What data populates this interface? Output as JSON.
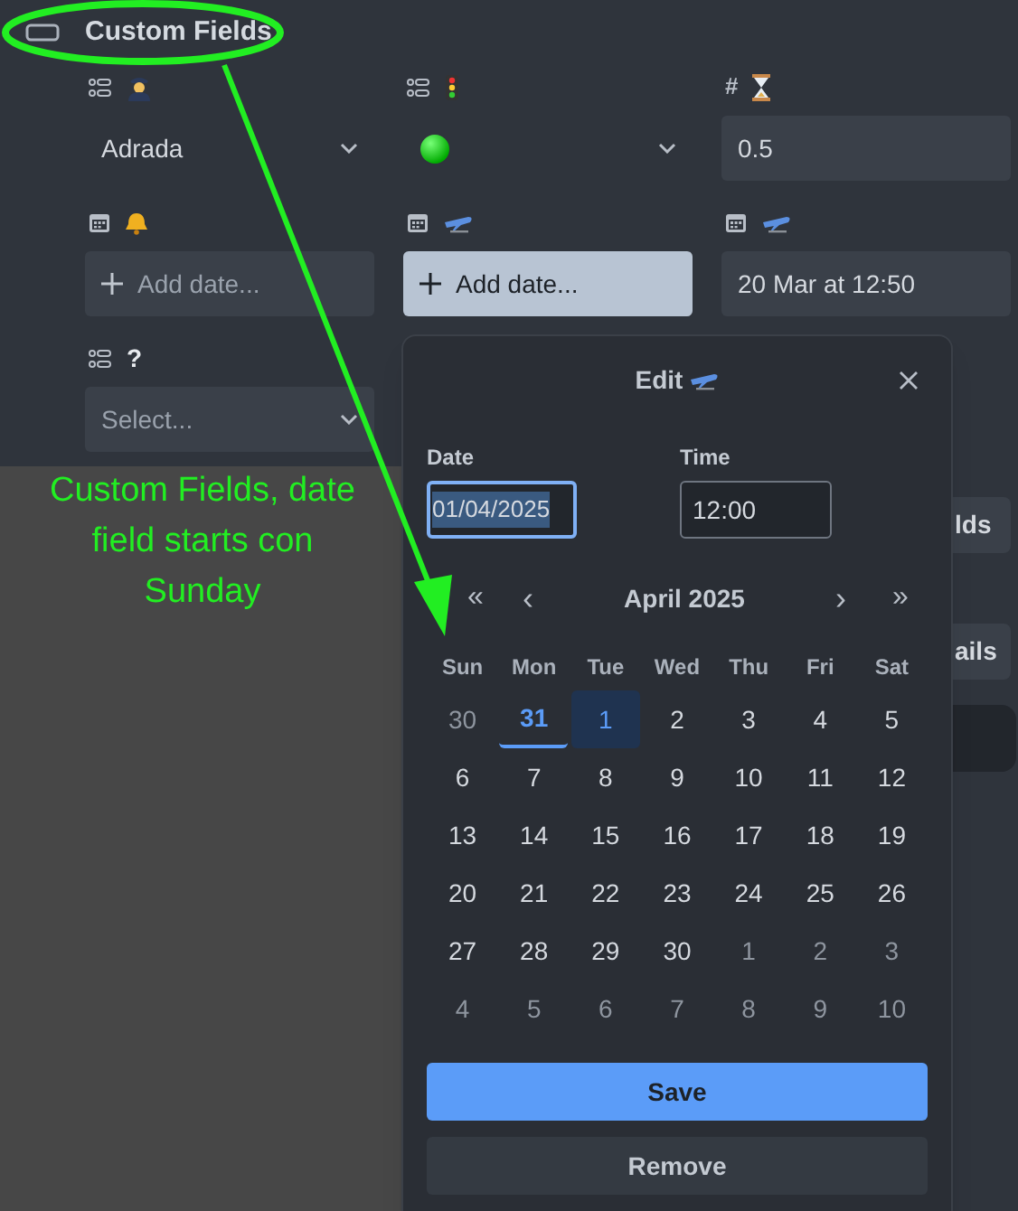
{
  "section": {
    "title": "Custom Fields"
  },
  "fields": [
    {
      "kind": "select",
      "value": "Adrada",
      "active": false
    },
    {
      "kind": "select",
      "active": false
    },
    {
      "kind": "number",
      "type_mark": "#",
      "value": "0.5",
      "active": false
    },
    {
      "kind": "date",
      "placeholder": "Add date...",
      "active": false
    },
    {
      "kind": "date",
      "placeholder": "Add date...",
      "active": true
    },
    {
      "kind": "date",
      "value": "20 Mar at 12:50",
      "active": false
    },
    {
      "kind": "select",
      "label": "?",
      "placeholder": "Select...",
      "active": false
    }
  ],
  "background_buttons": [
    "lds",
    "ails"
  ],
  "dialog": {
    "title": "Edit",
    "date_label": "Date",
    "date_value": "01/04/2025",
    "time_label": "Time",
    "time_value": "12:00",
    "nav": [
      "«",
      "‹",
      "›",
      "»"
    ],
    "month": "April 2025",
    "weekdays": [
      "Sun",
      "Mon",
      "Tue",
      "Wed",
      "Thu",
      "Fri",
      "Sat"
    ],
    "weeks": [
      [
        {
          "day": "30",
          "outside": true,
          "today": false,
          "selected": false
        },
        {
          "day": "31",
          "outside": true,
          "today": true,
          "selected": false
        },
        {
          "day": "1",
          "outside": false,
          "today": false,
          "selected": true
        },
        {
          "day": "2",
          "outside": false,
          "today": false,
          "selected": false
        },
        {
          "day": "3",
          "outside": false,
          "today": false,
          "selected": false
        },
        {
          "day": "4",
          "outside": false,
          "today": false,
          "selected": false
        },
        {
          "day": "5",
          "outside": false,
          "today": false,
          "selected": false
        }
      ],
      [
        {
          "day": "6",
          "outside": false,
          "today": false,
          "selected": false
        },
        {
          "day": "7",
          "outside": false,
          "today": false,
          "selected": false
        },
        {
          "day": "8",
          "outside": false,
          "today": false,
          "selected": false
        },
        {
          "day": "9",
          "outside": false,
          "today": false,
          "selected": false
        },
        {
          "day": "10",
          "outside": false,
          "today": false,
          "selected": false
        },
        {
          "day": "11",
          "outside": false,
          "today": false,
          "selected": false
        },
        {
          "day": "12",
          "outside": false,
          "today": false,
          "selected": false
        }
      ],
      [
        {
          "day": "13",
          "outside": false,
          "today": false,
          "selected": false
        },
        {
          "day": "14",
          "outside": false,
          "today": false,
          "selected": false
        },
        {
          "day": "15",
          "outside": false,
          "today": false,
          "selected": false
        },
        {
          "day": "16",
          "outside": false,
          "today": false,
          "selected": false
        },
        {
          "day": "17",
          "outside": false,
          "today": false,
          "selected": false
        },
        {
          "day": "18",
          "outside": false,
          "today": false,
          "selected": false
        },
        {
          "day": "19",
          "outside": false,
          "today": false,
          "selected": false
        }
      ],
      [
        {
          "day": "20",
          "outside": false,
          "today": false,
          "selected": false
        },
        {
          "day": "21",
          "outside": false,
          "today": false,
          "selected": false
        },
        {
          "day": "22",
          "outside": false,
          "today": false,
          "selected": false
        },
        {
          "day": "23",
          "outside": false,
          "today": false,
          "selected": false
        },
        {
          "day": "24",
          "outside": false,
          "today": false,
          "selected": false
        },
        {
          "day": "25",
          "outside": false,
          "today": false,
          "selected": false
        },
        {
          "day": "26",
          "outside": false,
          "today": false,
          "selected": false
        }
      ],
      [
        {
          "day": "27",
          "outside": false,
          "today": false,
          "selected": false
        },
        {
          "day": "28",
          "outside": false,
          "today": false,
          "selected": false
        },
        {
          "day": "29",
          "outside": false,
          "today": false,
          "selected": false
        },
        {
          "day": "30",
          "outside": false,
          "today": false,
          "selected": false
        },
        {
          "day": "1",
          "outside": true,
          "today": false,
          "selected": false
        },
        {
          "day": "2",
          "outside": true,
          "today": false,
          "selected": false
        },
        {
          "day": "3",
          "outside": true,
          "today": false,
          "selected": false
        }
      ],
      [
        {
          "day": "4",
          "outside": true,
          "today": false,
          "selected": false
        },
        {
          "day": "5",
          "outside": true,
          "today": false,
          "selected": false
        },
        {
          "day": "6",
          "outside": true,
          "today": false,
          "selected": false
        },
        {
          "day": "7",
          "outside": true,
          "today": false,
          "selected": false
        },
        {
          "day": "8",
          "outside": true,
          "today": false,
          "selected": false
        },
        {
          "day": "9",
          "outside": true,
          "today": false,
          "selected": false
        },
        {
          "day": "10",
          "outside": true,
          "today": false,
          "selected": false
        }
      ]
    ],
    "buttons": [
      "Save",
      "Remove"
    ]
  },
  "annotation": {
    "text": "Custom Fields, date field starts con Sunday"
  }
}
